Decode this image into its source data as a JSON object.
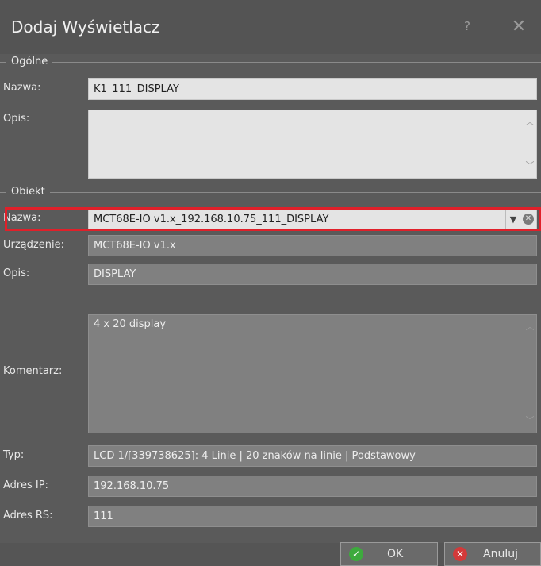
{
  "window": {
    "title": "Dodaj Wyświetlacz",
    "help_icon": "?",
    "close_icon": "✕"
  },
  "general": {
    "group_label": "Ogólne",
    "name_label": "Nazwa:",
    "name_value": "K1_111_DISPLAY",
    "desc_label": "Opis:",
    "desc_value": ""
  },
  "object": {
    "group_label": "Obiekt",
    "name_label": "Nazwa:",
    "name_value": "MCT68E-IO v1.x_192.168.10.75_111_DISPLAY",
    "device_label": "Urządzenie:",
    "device_value": "MCT68E-IO v1.x",
    "desc_label": "Opis:",
    "desc_value": "DISPLAY",
    "comment_label": "Komentarz:",
    "comment_value": "4 x 20 display",
    "type_label": "Typ:",
    "type_value": "LCD 1/[339738625]: 4 Linie | 20 znaków na linie | Podstawowy",
    "ip_label": "Adres IP:",
    "ip_value": "192.168.10.75",
    "rs_label": "Adres RS:",
    "rs_value": "111"
  },
  "buttons": {
    "ok": "OK",
    "cancel": "Anuluj"
  },
  "colors": {
    "highlight": "#e0202a",
    "ok_icon": "#3daa3d",
    "cancel_icon": "#d23a3a"
  }
}
